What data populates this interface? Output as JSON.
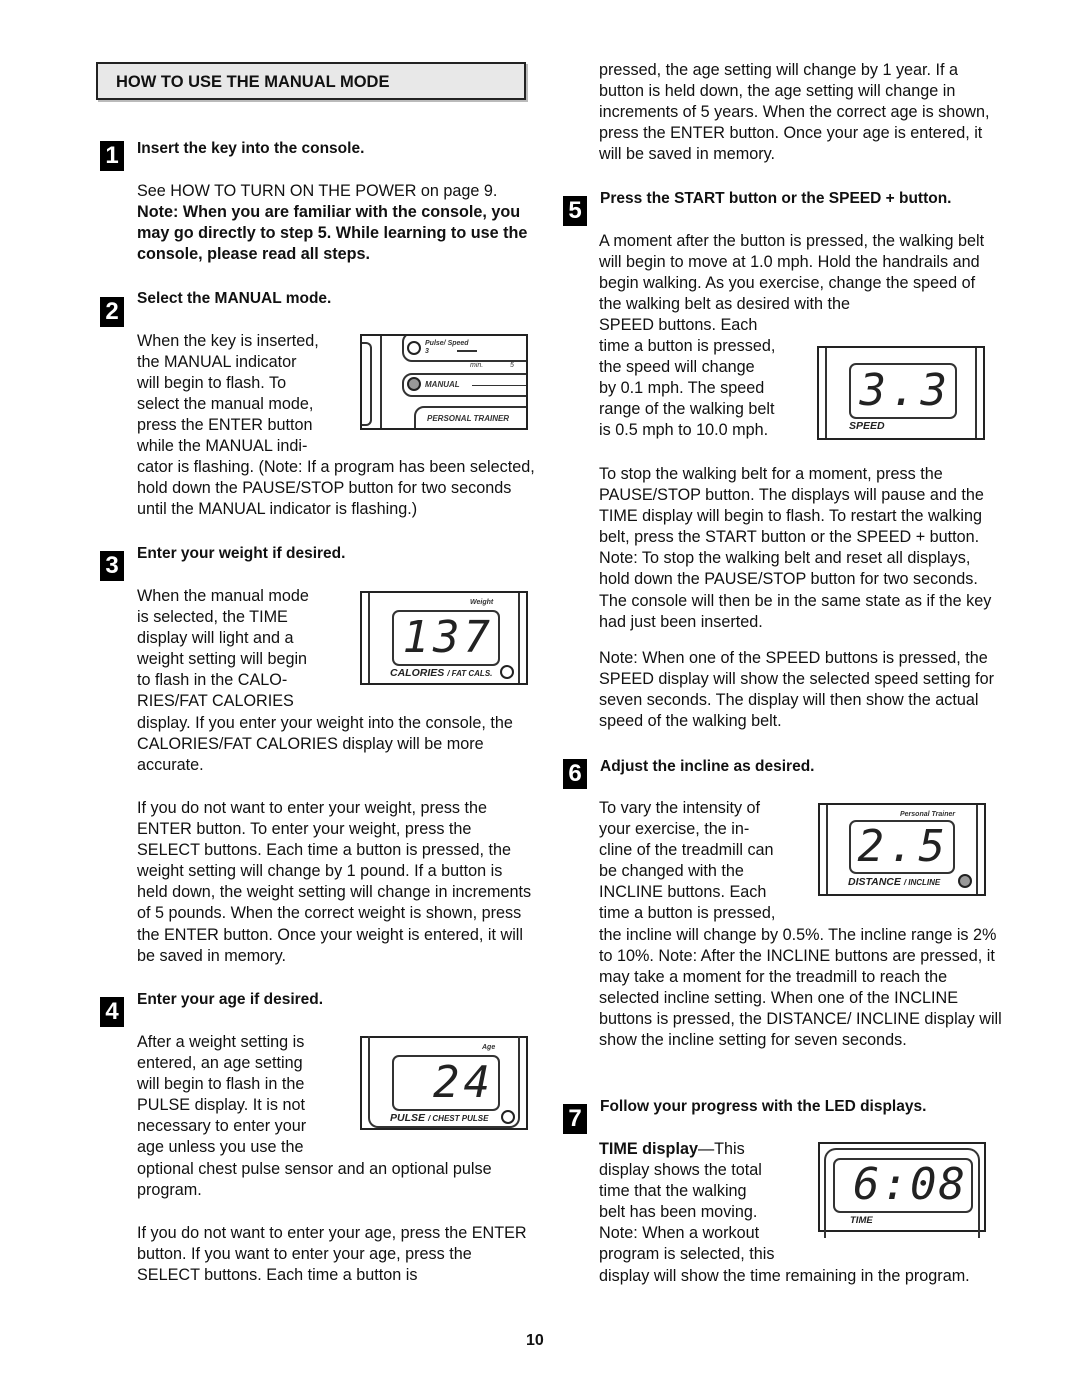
{
  "section_title": "HOW TO USE THE MANUAL MODE",
  "page_number": "10",
  "steps": [
    {
      "number": "1",
      "title": "Insert the key into the console.",
      "text": "See HOW TO TURN ON THE POWER on page 9.",
      "note_bold": "Note: When you are familiar with the console, you may go directly to step 5. While learning to use the console, please read all steps."
    },
    {
      "number": "2",
      "title": "Select the MANUAL mode.",
      "text_lines": [
        "When the key is inserted,",
        "the MANUAL indicator",
        "will begin to flash. To",
        "select the manual mode,",
        "press the ENTER button",
        "while the MANUAL indi-"
      ],
      "text_rest": "cator is flashing. (Note: If a program has been selected, hold down the PAUSE/STOP button for two seconds until the MANUAL indicator is flashing.)",
      "figure": {
        "top_label": "Pulse/ Speed 3",
        "min_label": "min.",
        "min_value": "5",
        "indicator_label": "MANUAL",
        "bottom_label": "PERSONAL TRAINER"
      }
    },
    {
      "number": "3",
      "title": "Enter your weight if desired.",
      "text_lines": [
        "When the manual mode",
        "is selected, the TIME",
        "display will light and a",
        "weight setting will begin",
        "to flash in the CALO-",
        "RIES/FAT CALORIES"
      ],
      "text_rest": "display. If you enter your weight into the console, the CALORIES/FAT CALORIES display will be more accurate.",
      "paragraph2": "If you do not want to enter your weight, press the ENTER button. To enter your weight, press the SELECT buttons. Each time a button is pressed, the weight setting will change by 1 pound. If a button is held down, the weight setting will change in increments of 5 pounds. When the correct weight is shown, press the ENTER button. Once your weight is entered, it will be saved in memory.",
      "figure": {
        "top_label": "Weight",
        "value": "137",
        "label_main": "CALORIES",
        "label_sub": "FAT CALS."
      }
    },
    {
      "number": "4",
      "title": "Enter your age if desired.",
      "text_lines": [
        "After a weight setting is",
        "entered, an age setting",
        "will begin to flash in the",
        "PULSE display. It is not",
        "necessary to enter your",
        "age unless you use the"
      ],
      "text_rest": "optional chest pulse sensor and an optional pulse program.",
      "paragraph2": "If you do not want to enter your age, press the ENTER button. If you want to enter your age, press the SELECT buttons. Each time a button is",
      "paragraph2_cont": "pressed, the age setting will change by 1 year. If a button is held down, the age setting will change in increments of 5 years. When the correct age is shown, press the ENTER button. Once your age is entered, it will be saved in memory.",
      "figure": {
        "top_label": "Age",
        "value": "24",
        "label_main": "PULSE",
        "label_sub": "CHEST PULSE"
      }
    },
    {
      "number": "5",
      "title": "Press the START button or the SPEED + button.",
      "text_top": "A moment after the button is pressed, the walking belt will begin to move at 1.0 mph. Hold the handrails and begin walking. As you exercise, change the speed of the walking belt as desired with the",
      "text_lines": [
        "SPEED buttons. Each",
        "time a button is pressed,",
        "the speed will change",
        "by 0.1 mph. The speed",
        "range of the walking belt",
        "is 0.5 mph to 10.0 mph."
      ],
      "paragraph2": "To stop the walking belt for a moment, press the PAUSE/STOP button. The displays will pause and the TIME display will begin to flash. To restart the walking belt, press the START button or the SPEED + button. Note: To stop the walking belt and reset all displays, hold down the PAUSE/STOP button for two seconds. The console will then be in the same state as if the key had just been inserted.",
      "paragraph3": "Note: When one of the SPEED buttons is pressed, the SPEED display will show the selected speed setting for seven seconds. The display will then show the actual speed of the walking belt.",
      "figure": {
        "value": "3.3",
        "label_main": "SPEED"
      }
    },
    {
      "number": "6",
      "title": "Adjust the incline as desired.",
      "text_lines": [
        "To vary the intensity of",
        "your exercise, the in-",
        "cline of the treadmill can",
        "be changed with the",
        "INCLINE buttons. Each",
        "time a button is pressed,"
      ],
      "text_rest": "the incline will change by 0.5%. The incline range is 2% to 10%. Note: After the INCLINE buttons are pressed, it may take a moment for the treadmill to reach the selected incline setting. When one of the INCLINE buttons is pressed, the DISTANCE/ INCLINE display will show the incline setting for seven seconds.",
      "figure": {
        "top_label": "Personal Trainer",
        "value": "2.5",
        "label_main": "DISTANCE",
        "label_sub": "INCLINE"
      }
    },
    {
      "number": "7",
      "title": "Follow your progress with the LED displays.",
      "lead_bold": "TIME display",
      "lead_rest": "—This",
      "text_lines": [
        "display shows the total",
        "time that the walking",
        "belt has been moving.",
        "Note: When a workout",
        "program is selected, this"
      ],
      "text_rest": "display will show the time remaining in the program.",
      "figure": {
        "value": "6:08",
        "label_main": "TIME"
      }
    }
  ]
}
